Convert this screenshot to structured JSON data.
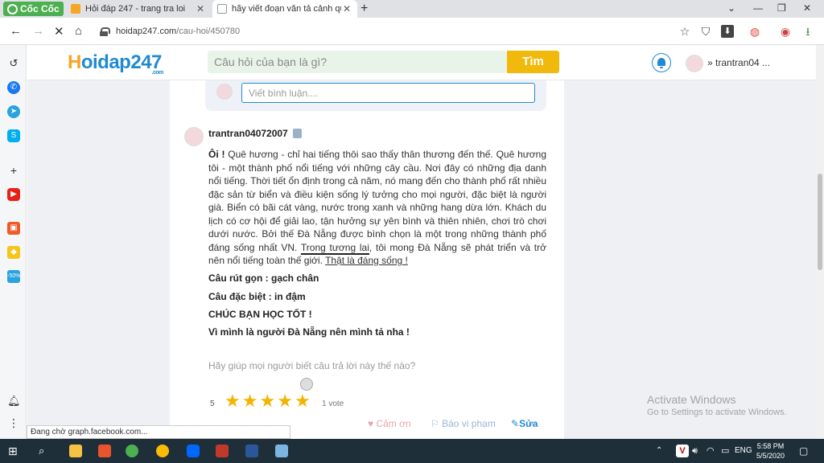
{
  "browser": {
    "brand": "Cốc Cốc",
    "tabs": [
      {
        "title": "Hỏi đáp 247 - trang tra loi",
        "active": false
      },
      {
        "title": "hãy viết đoạn văn tả cảnh qu",
        "active": true
      }
    ],
    "url_domain": "hoidap247.com",
    "url_path": "/cau-hoi/450780"
  },
  "site": {
    "logo_h": "H",
    "logo_rest": "oidap247",
    "logo_sub": ".com",
    "search_placeholder": "Câu hỏi của bạn là gì?",
    "search_button": "Tìm",
    "username": "trantran04 ..."
  },
  "comment_box": {
    "placeholder": "Viết bình luận...."
  },
  "answer": {
    "username": "trantran04072007",
    "bold_start": "Ôi !",
    "text_a": " Quê hương - chỉ hai tiếng thôi sao thấy thân thương đến thế. Quê hương tôi - một thành phố nổi tiếng với những cây cầu. Nơi đây có những địa danh nổi tiếng. Thời tiết ổn định trong cả năm, nó mang đến cho thành phố rất nhiều đặc sản từ biển và điều kiện sống lý tưởng cho mọi người, đặc biệt là người già. Biển có bãi cát vàng, nước trong xanh và những hang dừa lớn. Khách du lịch có cơ hội để giải lao, tận hưởng sự yên bình và thiên nhiên, chơi trò chơi dưới nước. Bởi thế Đà Nẵng được bình chọn là một trong những thành phố đáng sống nhất VN. ",
    "underline_1": "Trong tương lai",
    "text_b": ", tôi mong Đà Nẵng sẽ phát triển và trở nên nổi tiếng toàn thế giới. ",
    "underline_2": "Thật là đáng sống !",
    "lines": [
      "Câu rút gọn : gạch chân",
      "Câu đặc biệt : in đậm",
      "CHÚC BẠN HỌC TỐT !",
      "Vì mình là người Đà Nẵng nên mình tả nha !"
    ],
    "help_text": "Hãy giúp mọi người biết câu trả lời này thế nào?",
    "rating": "5",
    "rating_value": 5,
    "votes": "1 vote",
    "thanks": "Cảm ơn",
    "report": "Báo vi phạm",
    "edit": "Sửa"
  },
  "watermark": {
    "line1": "Activate Windows",
    "line2": "Go to Settings to activate Windows."
  },
  "status_bar": "Đang chờ graph.facebook.com...",
  "taskbar": {
    "lang": "ENG",
    "time": "5:58 PM",
    "date": "5/5/2020"
  },
  "colors": {
    "brand_blue": "#1f8ad1",
    "search_button": "#f0b90b",
    "star": "#f5b301"
  }
}
